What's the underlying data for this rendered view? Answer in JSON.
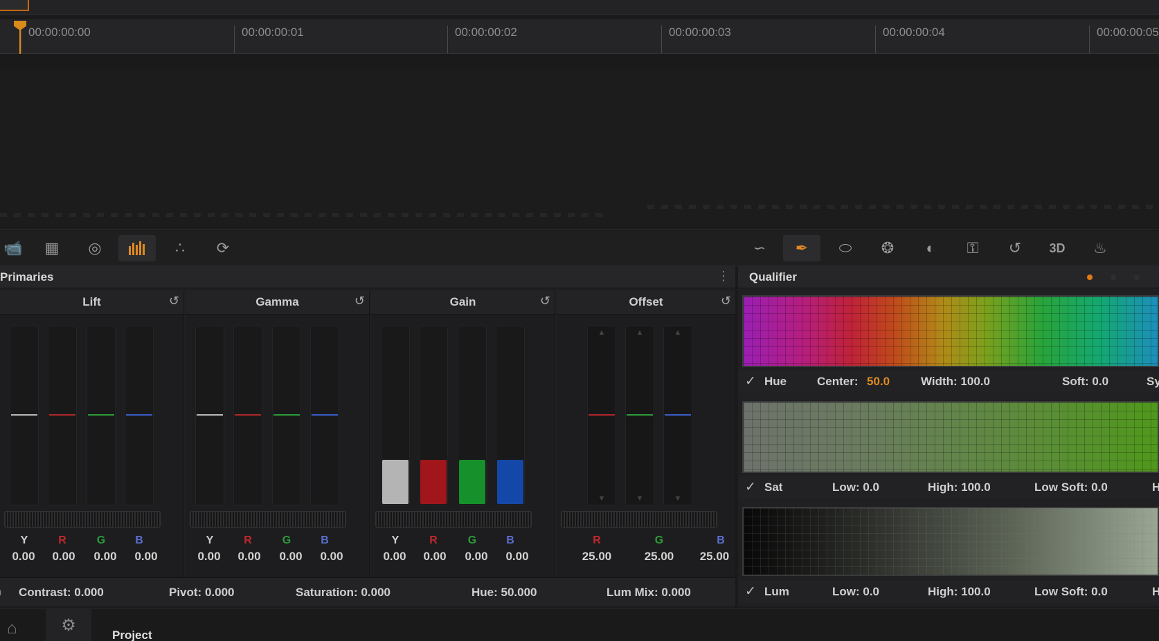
{
  "timeline": {
    "timecodes": [
      "00:00:00:00",
      "00:00:00:01",
      "00:00:00:02",
      "00:00:00:03",
      "00:00:00:04",
      "00:00:00:05"
    ]
  },
  "toolbar": {
    "left_icons": [
      "camera-icon",
      "grid-icon",
      "circle-target-icon",
      "primaries-bars-icon",
      "rgb-mixer-icon",
      "motion-icon"
    ],
    "right_icons": [
      "curves-icon",
      "eyedropper-icon",
      "window-icon",
      "tracker-icon",
      "blur-icon",
      "key-icon",
      "sizing-icon",
      "3d-icon",
      "fire-icon"
    ],
    "3d_label": "3D"
  },
  "primaries": {
    "title": "Primaries",
    "wheels": [
      {
        "name": "Lift",
        "channels": [
          {
            "label": "Y",
            "value": "0.00"
          },
          {
            "label": "R",
            "value": "0.00"
          },
          {
            "label": "G",
            "value": "0.00"
          },
          {
            "label": "B",
            "value": "0.00"
          }
        ]
      },
      {
        "name": "Gamma",
        "channels": [
          {
            "label": "Y",
            "value": "0.00"
          },
          {
            "label": "R",
            "value": "0.00"
          },
          {
            "label": "G",
            "value": "0.00"
          },
          {
            "label": "B",
            "value": "0.00"
          }
        ]
      },
      {
        "name": "Gain",
        "channels": [
          {
            "label": "Y",
            "value": "0.00"
          },
          {
            "label": "R",
            "value": "0.00"
          },
          {
            "label": "G",
            "value": "0.00"
          },
          {
            "label": "B",
            "value": "0.00"
          }
        ]
      },
      {
        "name": "Offset",
        "channels": [
          {
            "label": "R",
            "value": "25.00"
          },
          {
            "label": "G",
            "value": "25.00"
          },
          {
            "label": "B",
            "value": "25.00"
          }
        ]
      }
    ],
    "footer": {
      "contrast": "Contrast: 0.000",
      "pivot": "Pivot: 0.000",
      "saturation": "Saturation: 0.000",
      "hue": "Hue: 50.000",
      "lummix": "Lum Mix: 0.000"
    }
  },
  "qualifier": {
    "title": "Qualifier",
    "hue": {
      "label": "Hue",
      "center_label": "Center:",
      "center_value": "50.0",
      "width": "Width: 100.0",
      "soft": "Soft: 0.0",
      "extra": "Sy"
    },
    "sat": {
      "label": "Sat",
      "low": "Low: 0.0",
      "high": "High: 100.0",
      "low_soft": "Low Soft: 0.0",
      "extra": "H"
    },
    "lum": {
      "label": "Lum",
      "low": "Low: 0.0",
      "high": "High: 100.0",
      "low_soft": "Low Soft: 0.0",
      "extra": "H"
    }
  },
  "colors": {
    "accent": "#e08a20",
    "red": "#c0282c",
    "green": "#2e9a3a",
    "blue": "#3a5ec8"
  },
  "bottom": {
    "project_label": "Project"
  }
}
